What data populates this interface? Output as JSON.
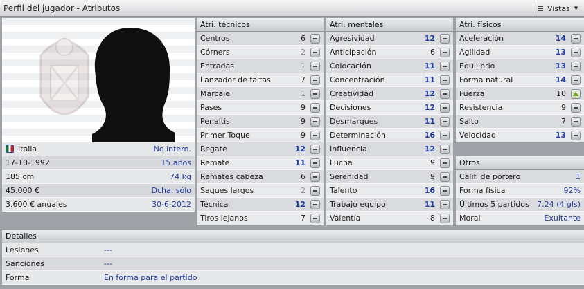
{
  "window": {
    "title": "Perfil del jugador - Atributos",
    "views_label": "Vistas"
  },
  "player_info": [
    {
      "label": "Italia",
      "value": "No intern.",
      "icon": "italy-flag-icon"
    },
    {
      "label": "17-10-1992",
      "value": "15 años"
    },
    {
      "label": "185 cm",
      "value": "74 kg"
    },
    {
      "label": "45.000 €",
      "value": "Dcha. sólo"
    },
    {
      "label": "3.600 € anuales",
      "value": "30-6-2012"
    }
  ],
  "technical": {
    "header": "Atri. técnicos",
    "rows": [
      {
        "name": "Centros",
        "value": "6",
        "style": "plain"
      },
      {
        "name": "Córners",
        "value": "2",
        "style": "gray"
      },
      {
        "name": "Entradas",
        "value": "1",
        "style": "gray"
      },
      {
        "name": "Lanzador de faltas",
        "value": "7",
        "style": "plain"
      },
      {
        "name": "Marcaje",
        "value": "1",
        "style": "gray"
      },
      {
        "name": "Pases",
        "value": "9",
        "style": "plain"
      },
      {
        "name": "Penaltis",
        "value": "9",
        "style": "plain"
      },
      {
        "name": "Primer Toque",
        "value": "9",
        "style": "plain"
      },
      {
        "name": "Regate",
        "value": "12",
        "style": "blue"
      },
      {
        "name": "Remate",
        "value": "11",
        "style": "blue"
      },
      {
        "name": "Remates cabeza",
        "value": "6",
        "style": "plain"
      },
      {
        "name": "Saques largos",
        "value": "2",
        "style": "gray"
      },
      {
        "name": "Técnica",
        "value": "12",
        "style": "blue"
      },
      {
        "name": "Tiros lejanos",
        "value": "7",
        "style": "plain"
      }
    ]
  },
  "mental": {
    "header": "Atri. mentales",
    "rows": [
      {
        "name": "Agresividad",
        "value": "12",
        "style": "blue"
      },
      {
        "name": "Anticipación",
        "value": "6",
        "style": "plain"
      },
      {
        "name": "Colocación",
        "value": "11",
        "style": "blue"
      },
      {
        "name": "Concentración",
        "value": "11",
        "style": "blue"
      },
      {
        "name": "Creatividad",
        "value": "12",
        "style": "blue"
      },
      {
        "name": "Decisiones",
        "value": "12",
        "style": "blue"
      },
      {
        "name": "Desmarques",
        "value": "11",
        "style": "blue"
      },
      {
        "name": "Determinación",
        "value": "16",
        "style": "blue"
      },
      {
        "name": "Influencia",
        "value": "12",
        "style": "blue"
      },
      {
        "name": "Lucha",
        "value": "9",
        "style": "plain"
      },
      {
        "name": "Serenidad",
        "value": "9",
        "style": "plain"
      },
      {
        "name": "Talento",
        "value": "16",
        "style": "blue"
      },
      {
        "name": "Trabajo equipo",
        "value": "11",
        "style": "blue"
      },
      {
        "name": "Valentía",
        "value": "8",
        "style": "plain"
      }
    ]
  },
  "physical": {
    "header": "Atri. físicos",
    "rows": [
      {
        "name": "Aceleración",
        "value": "14",
        "style": "blue",
        "trend": "flat"
      },
      {
        "name": "Agilidad",
        "value": "13",
        "style": "blue",
        "trend": "flat"
      },
      {
        "name": "Equilibrio",
        "value": "13",
        "style": "blue",
        "trend": "flat"
      },
      {
        "name": "Forma natural",
        "value": "14",
        "style": "blue",
        "trend": "flat"
      },
      {
        "name": "Fuerza",
        "value": "10",
        "style": "plain",
        "trend": "up"
      },
      {
        "name": "Resistencia",
        "value": "9",
        "style": "plain",
        "trend": "flat"
      },
      {
        "name": "Salto",
        "value": "7",
        "style": "plain",
        "trend": "flat"
      },
      {
        "name": "Velocidad",
        "value": "13",
        "style": "blue",
        "trend": "flat"
      }
    ]
  },
  "others": {
    "header": "Otros",
    "rows": [
      {
        "name": "Calif. de portero",
        "value": "1"
      },
      {
        "name": "Forma física",
        "value": "92%"
      },
      {
        "name": "Últimos 5 partidos",
        "value": "7.24 (4 gls)"
      },
      {
        "name": "Moral",
        "value": "Exultante"
      }
    ]
  },
  "details": {
    "header": "Detalles",
    "rows": [
      {
        "label": "Lesiones",
        "value": "---"
      },
      {
        "label": "Sanciones",
        "value": "---"
      },
      {
        "label": "Forma",
        "value": "En forma para el partido"
      }
    ]
  },
  "colors": {
    "value_blue": "#1d3a9e",
    "value_gray": "#8b8c8f",
    "trend_up": "#77aa22"
  }
}
